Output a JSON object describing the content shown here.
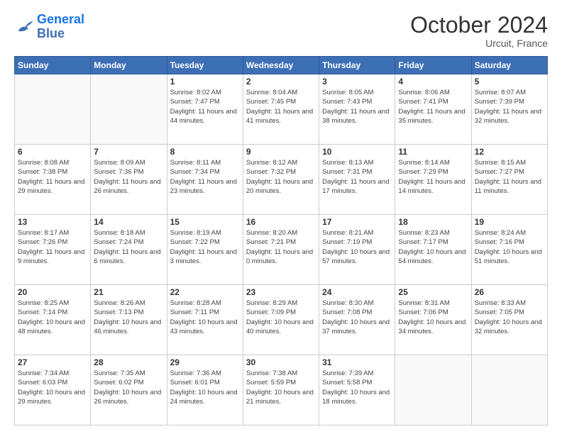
{
  "header": {
    "logo_general": "General",
    "logo_blue": "Blue",
    "month_title": "October 2024",
    "location": "Urcuit, France"
  },
  "weekdays": [
    "Sunday",
    "Monday",
    "Tuesday",
    "Wednesday",
    "Thursday",
    "Friday",
    "Saturday"
  ],
  "weeks": [
    [
      {
        "day": "",
        "sunrise": "",
        "sunset": "",
        "daylight": ""
      },
      {
        "day": "",
        "sunrise": "",
        "sunset": "",
        "daylight": ""
      },
      {
        "day": "1",
        "sunrise": "Sunrise: 8:02 AM",
        "sunset": "Sunset: 7:47 PM",
        "daylight": "Daylight: 11 hours and 44 minutes."
      },
      {
        "day": "2",
        "sunrise": "Sunrise: 8:04 AM",
        "sunset": "Sunset: 7:45 PM",
        "daylight": "Daylight: 11 hours and 41 minutes."
      },
      {
        "day": "3",
        "sunrise": "Sunrise: 8:05 AM",
        "sunset": "Sunset: 7:43 PM",
        "daylight": "Daylight: 11 hours and 38 minutes."
      },
      {
        "day": "4",
        "sunrise": "Sunrise: 8:06 AM",
        "sunset": "Sunset: 7:41 PM",
        "daylight": "Daylight: 11 hours and 35 minutes."
      },
      {
        "day": "5",
        "sunrise": "Sunrise: 8:07 AM",
        "sunset": "Sunset: 7:39 PM",
        "daylight": "Daylight: 11 hours and 32 minutes."
      }
    ],
    [
      {
        "day": "6",
        "sunrise": "Sunrise: 8:08 AM",
        "sunset": "Sunset: 7:38 PM",
        "daylight": "Daylight: 11 hours and 29 minutes."
      },
      {
        "day": "7",
        "sunrise": "Sunrise: 8:09 AM",
        "sunset": "Sunset: 7:36 PM",
        "daylight": "Daylight: 11 hours and 26 minutes."
      },
      {
        "day": "8",
        "sunrise": "Sunrise: 8:11 AM",
        "sunset": "Sunset: 7:34 PM",
        "daylight": "Daylight: 11 hours and 23 minutes."
      },
      {
        "day": "9",
        "sunrise": "Sunrise: 8:12 AM",
        "sunset": "Sunset: 7:32 PM",
        "daylight": "Daylight: 11 hours and 20 minutes."
      },
      {
        "day": "10",
        "sunrise": "Sunrise: 8:13 AM",
        "sunset": "Sunset: 7:31 PM",
        "daylight": "Daylight: 11 hours and 17 minutes."
      },
      {
        "day": "11",
        "sunrise": "Sunrise: 8:14 AM",
        "sunset": "Sunset: 7:29 PM",
        "daylight": "Daylight: 11 hours and 14 minutes."
      },
      {
        "day": "12",
        "sunrise": "Sunrise: 8:15 AM",
        "sunset": "Sunset: 7:27 PM",
        "daylight": "Daylight: 11 hours and 11 minutes."
      }
    ],
    [
      {
        "day": "13",
        "sunrise": "Sunrise: 8:17 AM",
        "sunset": "Sunset: 7:26 PM",
        "daylight": "Daylight: 11 hours and 9 minutes."
      },
      {
        "day": "14",
        "sunrise": "Sunrise: 8:18 AM",
        "sunset": "Sunset: 7:24 PM",
        "daylight": "Daylight: 11 hours and 6 minutes."
      },
      {
        "day": "15",
        "sunrise": "Sunrise: 8:19 AM",
        "sunset": "Sunset: 7:22 PM",
        "daylight": "Daylight: 11 hours and 3 minutes."
      },
      {
        "day": "16",
        "sunrise": "Sunrise: 8:20 AM",
        "sunset": "Sunset: 7:21 PM",
        "daylight": "Daylight: 11 hours and 0 minutes."
      },
      {
        "day": "17",
        "sunrise": "Sunrise: 8:21 AM",
        "sunset": "Sunset: 7:19 PM",
        "daylight": "Daylight: 10 hours and 57 minutes."
      },
      {
        "day": "18",
        "sunrise": "Sunrise: 8:23 AM",
        "sunset": "Sunset: 7:17 PM",
        "daylight": "Daylight: 10 hours and 54 minutes."
      },
      {
        "day": "19",
        "sunrise": "Sunrise: 8:24 AM",
        "sunset": "Sunset: 7:16 PM",
        "daylight": "Daylight: 10 hours and 51 minutes."
      }
    ],
    [
      {
        "day": "20",
        "sunrise": "Sunrise: 8:25 AM",
        "sunset": "Sunset: 7:14 PM",
        "daylight": "Daylight: 10 hours and 48 minutes."
      },
      {
        "day": "21",
        "sunrise": "Sunrise: 8:26 AM",
        "sunset": "Sunset: 7:13 PM",
        "daylight": "Daylight: 10 hours and 46 minutes."
      },
      {
        "day": "22",
        "sunrise": "Sunrise: 8:28 AM",
        "sunset": "Sunset: 7:11 PM",
        "daylight": "Daylight: 10 hours and 43 minutes."
      },
      {
        "day": "23",
        "sunrise": "Sunrise: 8:29 AM",
        "sunset": "Sunset: 7:09 PM",
        "daylight": "Daylight: 10 hours and 40 minutes."
      },
      {
        "day": "24",
        "sunrise": "Sunrise: 8:30 AM",
        "sunset": "Sunset: 7:08 PM",
        "daylight": "Daylight: 10 hours and 37 minutes."
      },
      {
        "day": "25",
        "sunrise": "Sunrise: 8:31 AM",
        "sunset": "Sunset: 7:06 PM",
        "daylight": "Daylight: 10 hours and 34 minutes."
      },
      {
        "day": "26",
        "sunrise": "Sunrise: 8:33 AM",
        "sunset": "Sunset: 7:05 PM",
        "daylight": "Daylight: 10 hours and 32 minutes."
      }
    ],
    [
      {
        "day": "27",
        "sunrise": "Sunrise: 7:34 AM",
        "sunset": "Sunset: 6:03 PM",
        "daylight": "Daylight: 10 hours and 29 minutes."
      },
      {
        "day": "28",
        "sunrise": "Sunrise: 7:35 AM",
        "sunset": "Sunset: 6:02 PM",
        "daylight": "Daylight: 10 hours and 26 minutes."
      },
      {
        "day": "29",
        "sunrise": "Sunrise: 7:36 AM",
        "sunset": "Sunset: 6:01 PM",
        "daylight": "Daylight: 10 hours and 24 minutes."
      },
      {
        "day": "30",
        "sunrise": "Sunrise: 7:38 AM",
        "sunset": "Sunset: 5:59 PM",
        "daylight": "Daylight: 10 hours and 21 minutes."
      },
      {
        "day": "31",
        "sunrise": "Sunrise: 7:39 AM",
        "sunset": "Sunset: 5:58 PM",
        "daylight": "Daylight: 10 hours and 18 minutes."
      },
      {
        "day": "",
        "sunrise": "",
        "sunset": "",
        "daylight": ""
      },
      {
        "day": "",
        "sunrise": "",
        "sunset": "",
        "daylight": ""
      }
    ]
  ]
}
